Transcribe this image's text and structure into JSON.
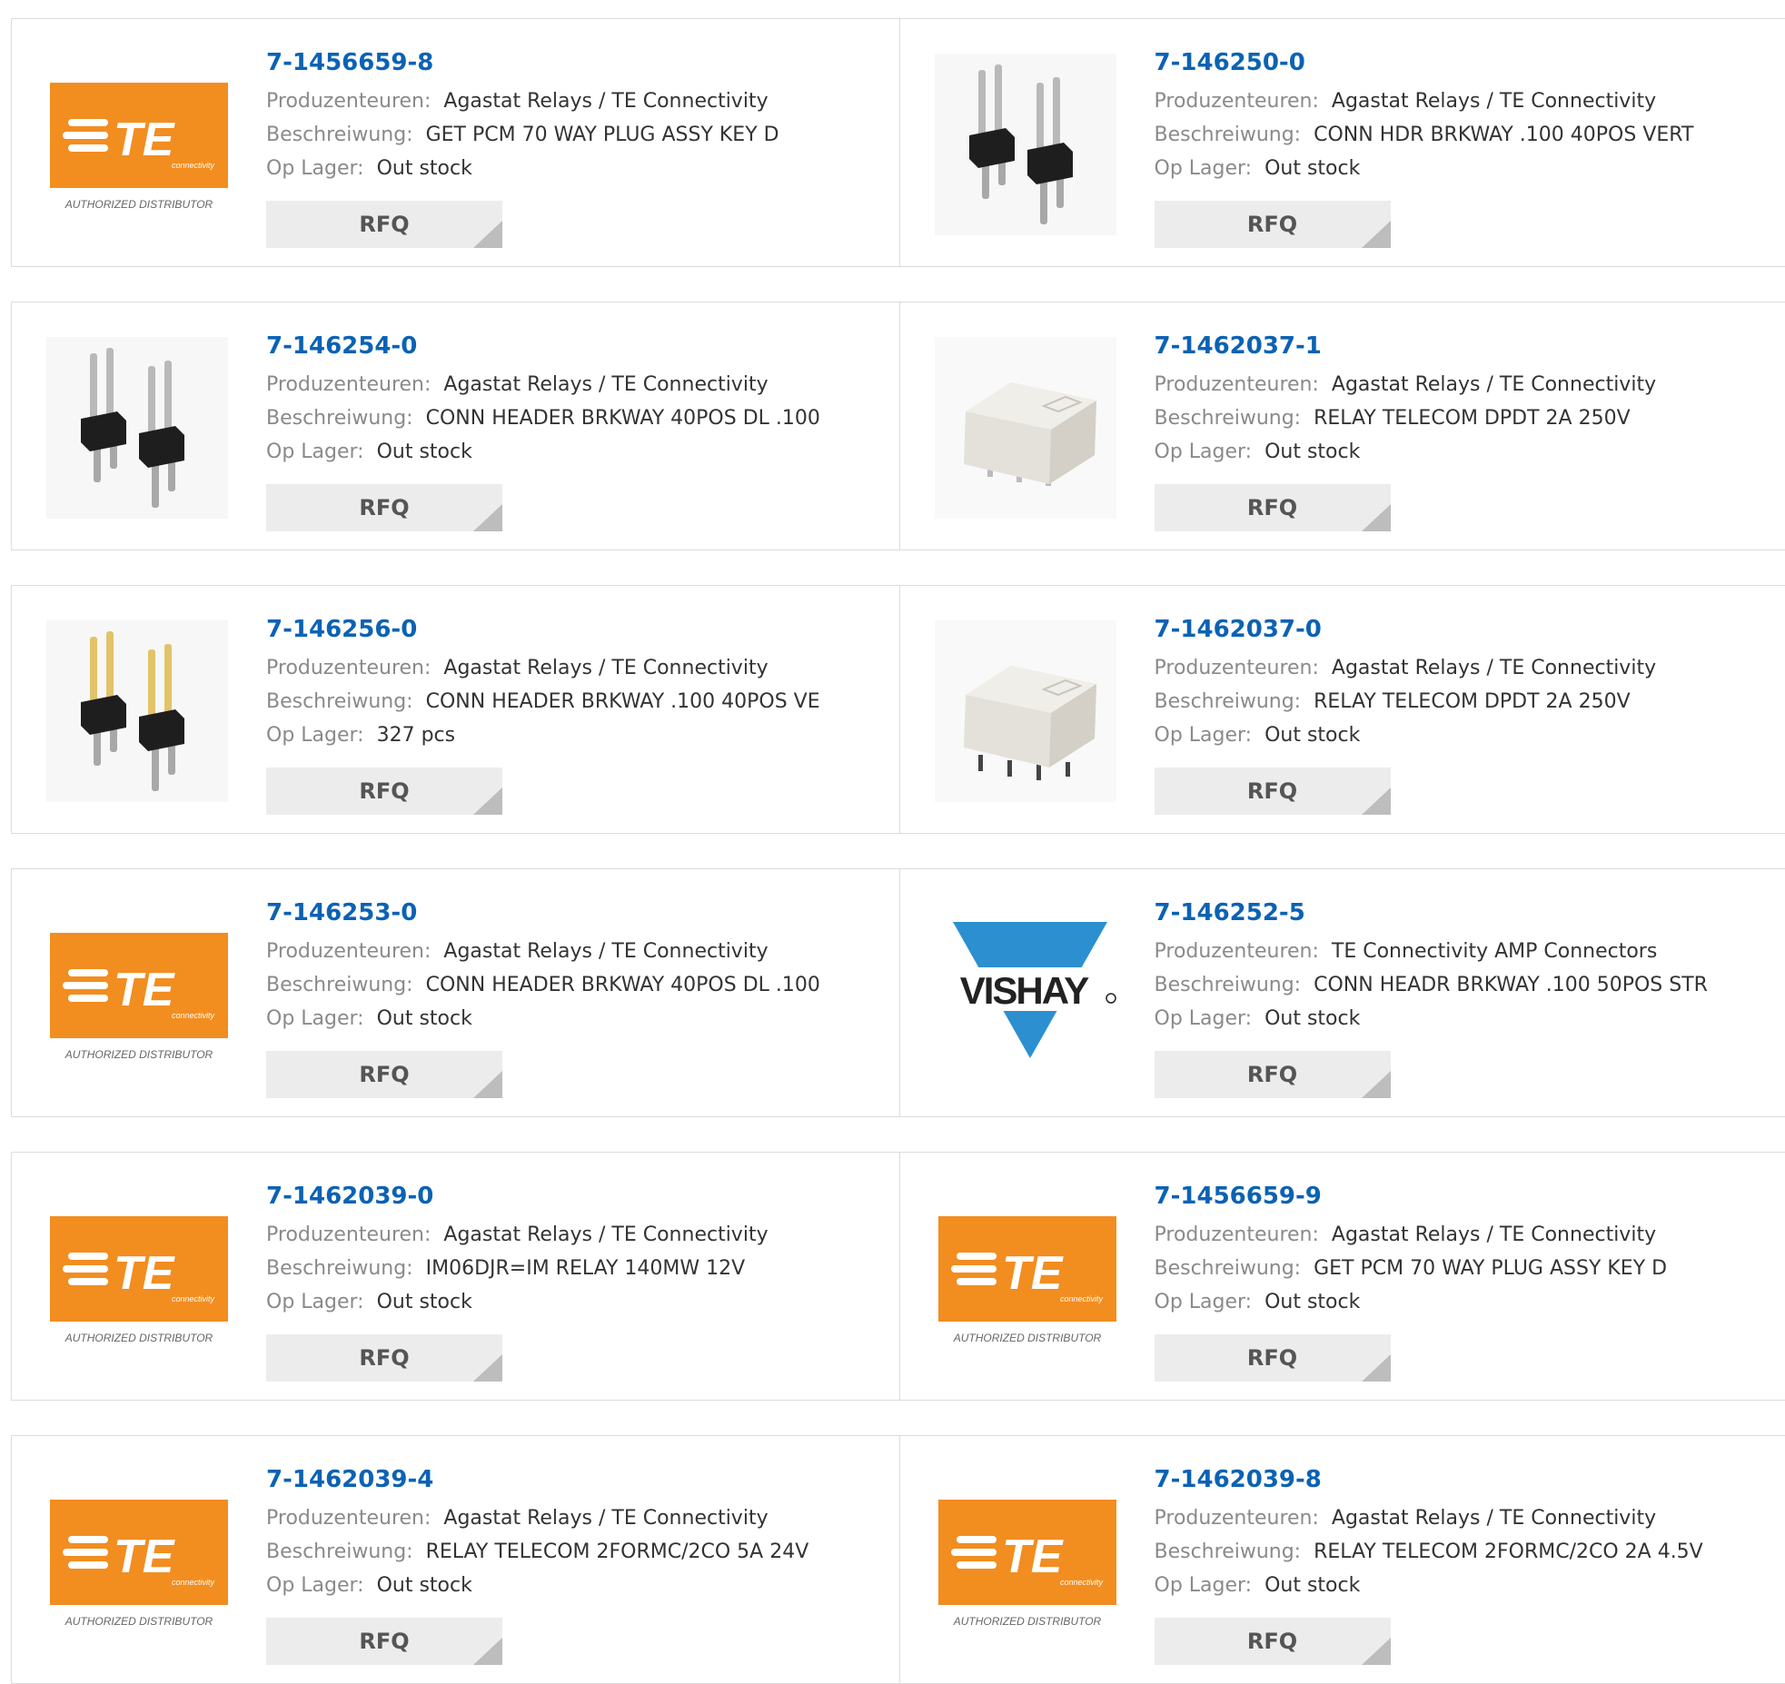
{
  "labels": {
    "manufacturer": "Produzenteuren:",
    "description": "Beschreiwung:",
    "stock": "Op Lager:",
    "rfq": "RFQ"
  },
  "logos": {
    "te_text": "TE",
    "te_sub": "connectivity",
    "te_distributor": "AUTHORIZED DISTRIBUTOR",
    "vishay_text": "VISHAY"
  },
  "colors": {
    "part_link": "#0b62b4",
    "te_orange": "#f28d20",
    "vishay_blue": "#2b8fd0"
  },
  "products": [
    {
      "part": "7-1456659-8",
      "manufacturer": "Agastat Relays / TE Connectivity",
      "description": "GET PCM 70 WAY PLUG ASSY KEY D",
      "stock": "Out stock",
      "image": "te-logo"
    },
    {
      "part": "7-146250-0",
      "manufacturer": "Agastat Relays / TE Connectivity",
      "description": "CONN HDR BRKWAY .100 40POS VERT",
      "stock": "Out stock",
      "image": "pin-header"
    },
    {
      "part": "7-146254-0",
      "manufacturer": "Agastat Relays / TE Connectivity",
      "description": "CONN HEADER BRKWAY 40POS DL .100",
      "stock": "Out stock",
      "image": "pin-header"
    },
    {
      "part": "7-1462037-1",
      "manufacturer": "Agastat Relays / TE Connectivity",
      "description": "RELAY TELECOM DPDT 2A 250V",
      "stock": "Out stock",
      "image": "relay"
    },
    {
      "part": "7-146256-0",
      "manufacturer": "Agastat Relays / TE Connectivity",
      "description": "CONN HEADER BRKWAY .100 40POS VE",
      "stock": "327 pcs",
      "image": "pin-header-gold"
    },
    {
      "part": "7-1462037-0",
      "manufacturer": "Agastat Relays / TE Connectivity",
      "description": "RELAY TELECOM DPDT 2A 250V",
      "stock": "Out stock",
      "image": "relay-smd"
    },
    {
      "part": "7-146253-0",
      "manufacturer": "Agastat Relays / TE Connectivity",
      "description": "CONN HEADER BRKWAY 40POS DL .100",
      "stock": "Out stock",
      "image": "te-logo"
    },
    {
      "part": "7-146252-5",
      "manufacturer": "TE Connectivity AMP Connectors",
      "description": "CONN HEADR BRKWAY .100 50POS STR",
      "stock": "Out stock",
      "image": "vishay-logo"
    },
    {
      "part": "7-1462039-0",
      "manufacturer": "Agastat Relays / TE Connectivity",
      "description": "IM06DJR=IM RELAY 140MW 12V",
      "stock": "Out stock",
      "image": "te-logo"
    },
    {
      "part": "7-1456659-9",
      "manufacturer": "Agastat Relays / TE Connectivity",
      "description": "GET PCM 70 WAY PLUG ASSY KEY D",
      "stock": "Out stock",
      "image": "te-logo"
    },
    {
      "part": "7-1462039-4",
      "manufacturer": "Agastat Relays / TE Connectivity",
      "description": "RELAY TELECOM 2FORMC/2CO 5A 24V",
      "stock": "Out stock",
      "image": "te-logo"
    },
    {
      "part": "7-1462039-8",
      "manufacturer": "Agastat Relays / TE Connectivity",
      "description": "RELAY TELECOM 2FORMC/2CO 2A 4.5V",
      "stock": "Out stock",
      "image": "te-logo"
    }
  ]
}
